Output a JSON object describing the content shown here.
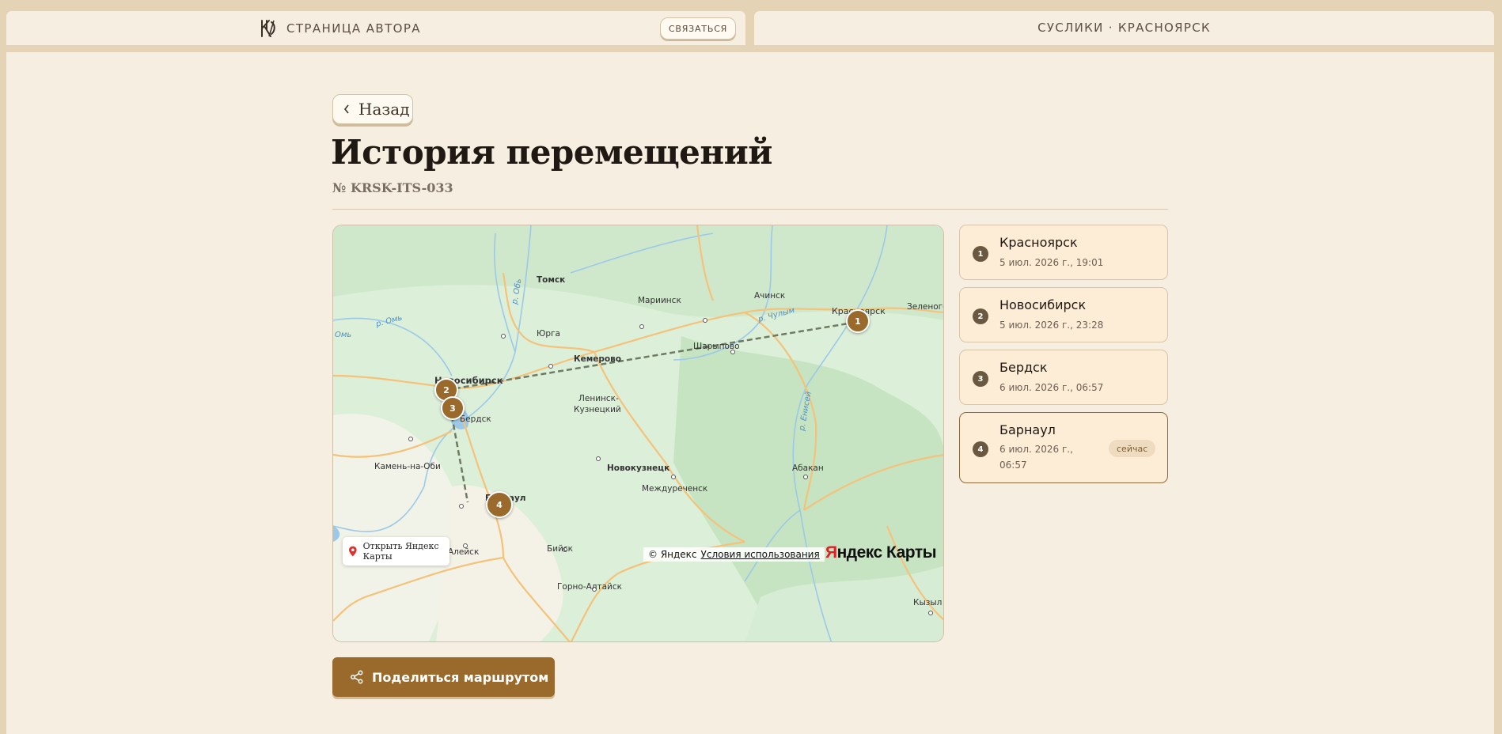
{
  "header": {
    "brand_text": "СТРАНИЦА АВТОРА",
    "contact_label": "СВЯЗАТЬСЯ",
    "breadcrumb": "СУСЛИКИ · КРАСНОЯРСК"
  },
  "page": {
    "back_label": "Назад",
    "title": "История перемещений",
    "number": "№ KRSK-ITS-033"
  },
  "map": {
    "open_label": "Открыть Яндекс Карты",
    "attribution": "© Яндекс",
    "terms": "Условия использования",
    "logo_red": "Я",
    "logo_rest": "ндекс Карты",
    "labels": {
      "tomsk": "Томск",
      "mariinsk": "Мариинск",
      "achinsk": "Ачинск",
      "krasnoyarsk": "Красноярск",
      "zelenogorsk": "Зеленого",
      "yurga": "Юрга",
      "kemerovo": "Кемерово",
      "sharypovo": "Шарыпово",
      "novosibirsk": "Новосибирск",
      "leninsk": "Ленинск-",
      "kuznetsky": "Кузнецкий",
      "berdsk": "Бердск",
      "kamen": "Камень-на-Оби",
      "novokuznetsk": "Новокузнецк",
      "abakan": "Абакан",
      "mezhdurechensk": "Междуреченск",
      "barnaul": "Барнаул",
      "aleysk": "Алейск",
      "biysk": "Бийск",
      "gorno": "Горно-Алтайск",
      "kyzyl": "Кызыл",
      "omsk_river": "Омь",
      "omsk_river2": "р. Омь",
      "ob_river": "р. Обь",
      "chulym": "р. Чулым",
      "yenisei": "р. Енисей"
    },
    "route_color": "#6f7a62",
    "marker_color": "#9a6a2c",
    "markers": [
      "1",
      "2",
      "3",
      "4"
    ]
  },
  "stops": [
    {
      "num": "1",
      "city": "Красноярск",
      "time": "5 июл. 2026 г., 19:01"
    },
    {
      "num": "2",
      "city": "Новосибирск",
      "time": "5 июл. 2026 г., 23:28"
    },
    {
      "num": "3",
      "city": "Бердск",
      "time": "6 июл. 2026 г., 06:57"
    },
    {
      "num": "4",
      "city": "Барнаул",
      "time": "6 июл. 2026 г., 06:57",
      "badge": "сейчас"
    }
  ],
  "share_label": "Поделиться маршрутом"
}
